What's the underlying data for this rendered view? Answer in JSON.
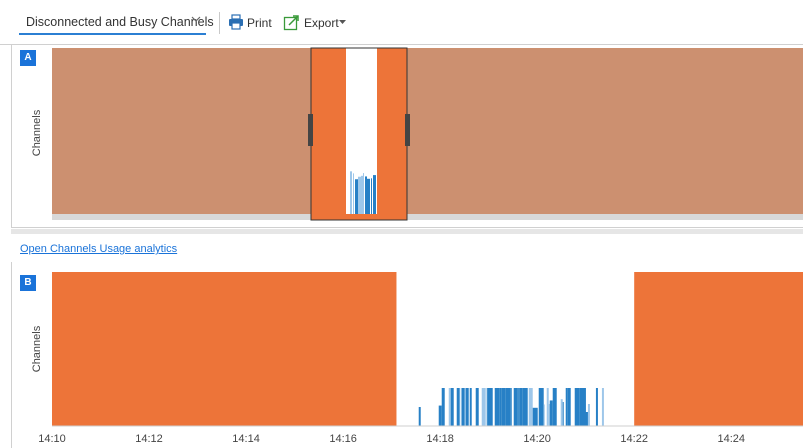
{
  "toolbar": {
    "view_select": {
      "selected": "Disconnected and Busy Channels"
    },
    "print_label": "Print",
    "export_label": "Export"
  },
  "panel_a": {
    "badge": "A",
    "ylabel": "Channels"
  },
  "panel_b": {
    "badge": "B",
    "ylabel": "Channels"
  },
  "analytics_link": "Open Channels Usage analytics",
  "colors": {
    "busy_orange": "#ed7439",
    "overview_faded": "#cc9070",
    "usage_blue": "#2780c6",
    "accent": "#1a73d9"
  },
  "chart_data": [
    {
      "id": "overview",
      "type": "timeline",
      "ylabel": "Channels",
      "x_axis_labels": [],
      "view_window": {
        "start": "14:17.0",
        "end": "14:21.5"
      }
    },
    {
      "id": "detail",
      "type": "timeline",
      "ylabel": "Channels",
      "x_axis_labels": [
        "14:10",
        "14:12",
        "14:14",
        "14:16",
        "14:18",
        "14:20",
        "14:22",
        "14:24"
      ],
      "x_range_minutes": [
        10,
        25.5
      ],
      "busy_intervals": [
        {
          "start_minute": 10,
          "end_minute": 17.1
        },
        {
          "start_minute": 22.0,
          "end_minute": 25.5
        }
      ],
      "usage_start_minute": 17.6,
      "usage_end_minute": 21.5
    }
  ]
}
